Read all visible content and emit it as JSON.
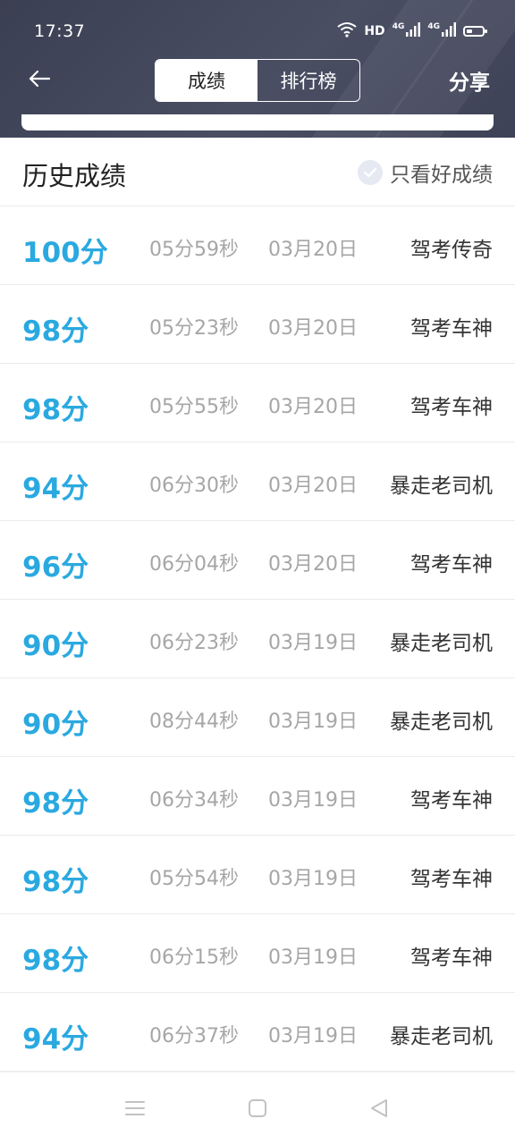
{
  "status_bar": {
    "time": "17:37",
    "network_label": "HD",
    "sim1": "4G",
    "sim2": "4G",
    "battery_level": 0.35
  },
  "header": {
    "tabs": [
      {
        "label": "成绩",
        "active": true
      },
      {
        "label": "排行榜",
        "active": false
      }
    ],
    "share_label": "分享"
  },
  "section": {
    "title": "历史成绩",
    "filter_label": "只看好成绩"
  },
  "records": [
    {
      "score": "100分",
      "duration": "05分59秒",
      "date": "03月20日",
      "title": "驾考传奇"
    },
    {
      "score": "98分",
      "duration": "05分23秒",
      "date": "03月20日",
      "title": "驾考车神"
    },
    {
      "score": "98分",
      "duration": "05分55秒",
      "date": "03月20日",
      "title": "驾考车神"
    },
    {
      "score": "94分",
      "duration": "06分30秒",
      "date": "03月20日",
      "title": "暴走老司机"
    },
    {
      "score": "96分",
      "duration": "06分04秒",
      "date": "03月20日",
      "title": "驾考车神"
    },
    {
      "score": "90分",
      "duration": "06分23秒",
      "date": "03月19日",
      "title": "暴走老司机"
    },
    {
      "score": "90分",
      "duration": "08分44秒",
      "date": "03月19日",
      "title": "暴走老司机"
    },
    {
      "score": "98分",
      "duration": "06分34秒",
      "date": "03月19日",
      "title": "驾考车神"
    },
    {
      "score": "98分",
      "duration": "05分54秒",
      "date": "03月19日",
      "title": "驾考车神"
    },
    {
      "score": "98分",
      "duration": "06分15秒",
      "date": "03月19日",
      "title": "驾考车神"
    },
    {
      "score": "94分",
      "duration": "06分37秒",
      "date": "03月19日",
      "title": "暴走老司机"
    }
  ],
  "colors": {
    "score": "#2aa9e0",
    "header_bg": "#3f4357",
    "muted_text": "#a6a6a6"
  },
  "icons": {
    "back": "arrow-left-icon",
    "filter": "check-circle-icon",
    "nav_menu": "menu-icon",
    "nav_home": "square-icon",
    "nav_back": "triangle-back-icon"
  }
}
